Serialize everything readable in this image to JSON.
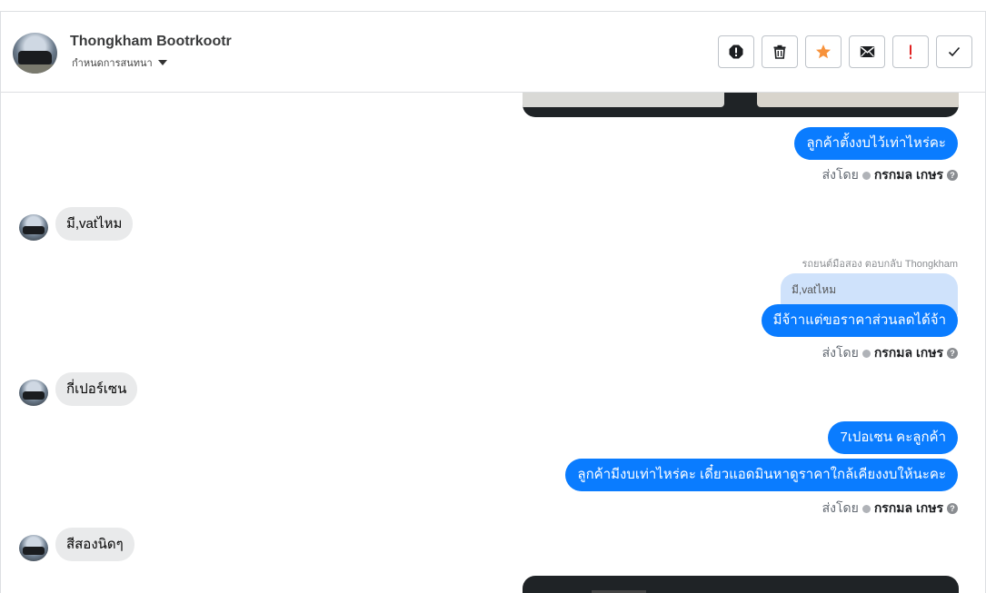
{
  "header": {
    "contact_name": "Thongkham Bootrkootr",
    "assign_label": "กำหนดการสนทนา"
  },
  "actions": [
    {
      "name": "spam-button",
      "icon": "alert-octagon-icon"
    },
    {
      "name": "delete-button",
      "icon": "trash-icon"
    },
    {
      "name": "star-button",
      "icon": "star-icon",
      "color": "#f7923b"
    },
    {
      "name": "mark-unread-button",
      "icon": "envelope-icon"
    },
    {
      "name": "important-button",
      "icon": "exclamation-icon",
      "color": "#e02020"
    },
    {
      "name": "done-button",
      "icon": "check-icon"
    }
  ],
  "messages": {
    "m1": "ลูกค้าตั้งงบไว้เท่าไหร่คะ",
    "sent1_prefix": "ส่งโดย",
    "sent1_agent": "กรกมล เกษร",
    "m2": "มี,vatไหม",
    "reply_meta": "รถยนต์มือสอง ตอบกลับ Thongkham",
    "reply_quote": "มี,vatไหม",
    "m3": "มีจ้าาแต่ขอราคาส่วนลดได้จ้า",
    "sent2_prefix": "ส่งโดย",
    "sent2_agent": "กรกมล เกษร",
    "m4": "กี่เปอร์เซน",
    "m5": "7เปอเซน คะลูกค้า",
    "m6": "ลูกค้ามีงบเท่าไหร่คะ เดี๋ยวแอดมินหาดูราคาใกล้เคียงงบให้นะคะ",
    "sent3_prefix": "ส่งโดย",
    "sent3_agent": "กรกมล เกษร",
    "m7": "สีสองนิดๆ"
  },
  "colors": {
    "outgoing_bubble": "#0a7cff",
    "incoming_bubble": "#e9eaeb",
    "reply_quote": "#cfe2fb"
  }
}
